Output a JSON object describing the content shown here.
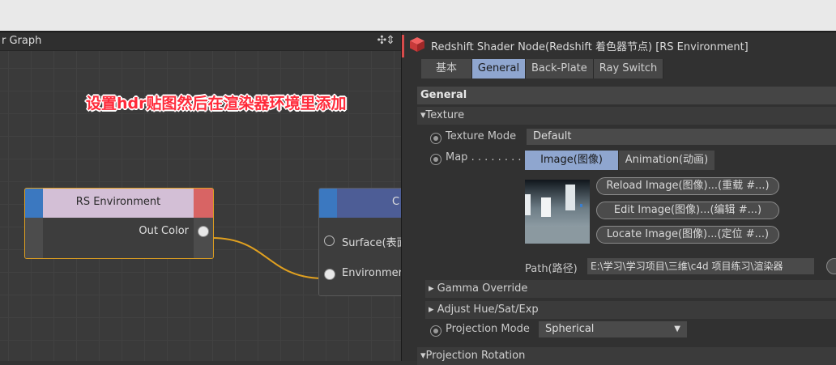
{
  "graph": {
    "header_title": "r Graph",
    "annotation": "设置hdr贴图然后在渲染器环境里添加",
    "node_env": {
      "title": "RS Environment",
      "output": "Out Color"
    },
    "node_out": {
      "title": "C",
      "input1": "Surface(表面",
      "input2": "Environmen"
    }
  },
  "panel": {
    "title": "Redshift Shader Node(Redshift 着色器节点) [RS Environment]",
    "tabs": [
      "基本",
      "General",
      "Back-Plate",
      "Ray Switch"
    ],
    "active_tab": "General",
    "section": "General",
    "texture_group": "▾Texture",
    "texture_mode": {
      "label": "Texture Mode",
      "value": "Default"
    },
    "map": {
      "label": "Map . . . . . . . .",
      "toggle": [
        "Image(图像)",
        "Animation(动画)"
      ],
      "active": "Image(图像)",
      "buttons": [
        "Reload Image(图像)...(重载 #...)",
        "Edit Image(图像)...(编辑 #...)",
        "Locate Image(图像)...(定位 #...)"
      ],
      "path_label": "Path(路径)",
      "path_value": "E:\\学习\\学习项目\\三维\\c4d 项目练习\\渲染器"
    },
    "gamma_override": "▸ Gamma Override",
    "adjust": "▸ Adjust Hue/Sat/Exp",
    "projection_mode": {
      "label": "Projection Mode",
      "value": "Spherical"
    },
    "projection_rotation": "▾Projection Rotation"
  },
  "colors": {
    "node_env_header": "#d3bfd6",
    "node_out_header": "#4d5d96",
    "active_tab": "#8fa6cf",
    "wire": "#e0a020",
    "annotation": "#ff2a3a"
  }
}
